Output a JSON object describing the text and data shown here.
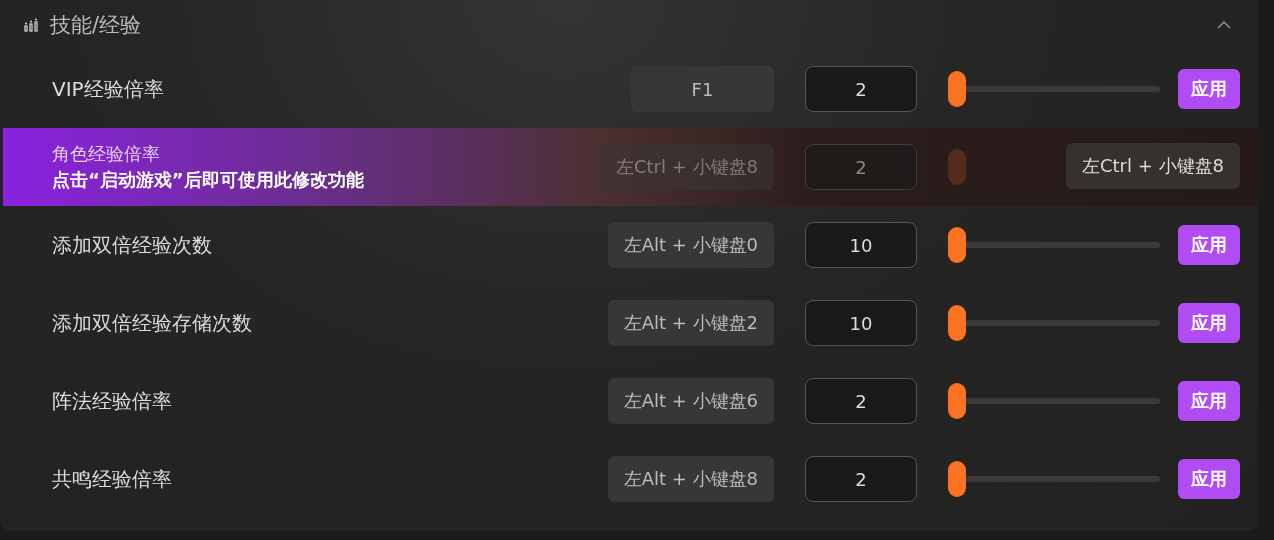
{
  "section": {
    "title": "技能/经验",
    "expanded": true
  },
  "rows": [
    {
      "kind": "setting",
      "label": "VIP经验倍率",
      "hotkey": "F1",
      "value": "2",
      "level": 0,
      "apply": "应用"
    },
    {
      "kind": "locked",
      "label": "角色经验倍率",
      "hotkey": "左Ctrl + 小键盘8",
      "value": "2",
      "notice": "点击“启动游戏”后即可使用此修改功能",
      "overlay_hotkey": "左Ctrl + 小键盘8"
    },
    {
      "kind": "setting",
      "label": "添加双倍经验次数",
      "hotkey": "左Alt + 小键盘0",
      "value": "10",
      "level": 0,
      "apply": "应用"
    },
    {
      "kind": "setting",
      "label": "添加双倍经验存储次数",
      "hotkey": "左Alt + 小键盘2",
      "value": "10",
      "level": 0,
      "apply": "应用"
    },
    {
      "kind": "setting",
      "label": "阵法经验倍率",
      "hotkey": "左Alt + 小键盘6",
      "value": "2",
      "level": 0,
      "apply": "应用"
    },
    {
      "kind": "setting",
      "label": "共鸣经验倍率",
      "hotkey": "左Alt + 小键盘8",
      "value": "2",
      "level": 0,
      "apply": "应用"
    }
  ]
}
